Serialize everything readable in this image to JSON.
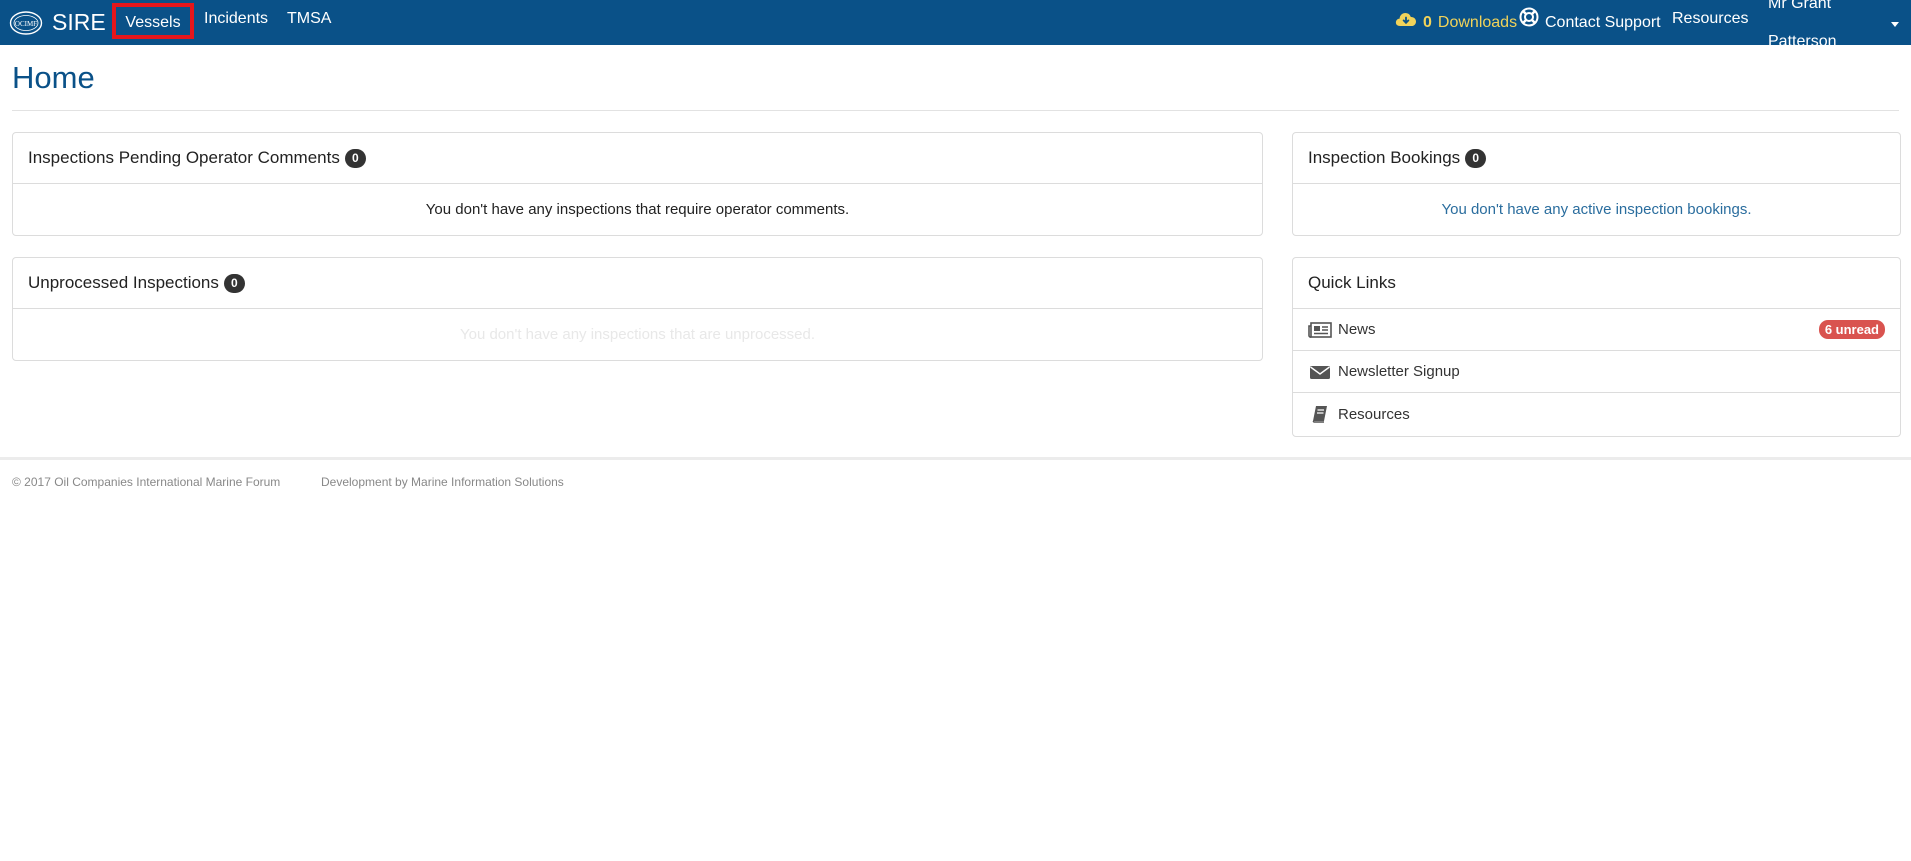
{
  "navbar": {
    "logo_text": "OCIMF",
    "brand": "SIRE",
    "items": [
      {
        "label": "Vessels"
      },
      {
        "label": "Incidents"
      },
      {
        "label": "TMSA"
      }
    ],
    "downloads_count": "0",
    "downloads_label": "Downloads",
    "support_label": "Contact Support",
    "resources_label": "Resources",
    "user_label": "Mr Grant Patterson"
  },
  "page": {
    "title": "Home"
  },
  "panels": {
    "comments": {
      "title": "Inspections Pending Operator Comments",
      "count": "0",
      "message": "You don't have any inspections that require operator comments."
    },
    "unprocessed": {
      "title": "Unprocessed Inspections",
      "count": "0",
      "message": "You don't have any inspections that are unprocessed."
    },
    "bookings": {
      "title": "Inspection Bookings",
      "count": "0",
      "message": "You don't have any active inspection bookings."
    },
    "quick_links": {
      "title": "Quick Links",
      "items": [
        {
          "label": "News",
          "icon": "newspaper-icon",
          "badge": "6 unread"
        },
        {
          "label": "Newsletter Signup",
          "icon": "envelope-icon"
        },
        {
          "label": "Resources",
          "icon": "book-icon"
        }
      ]
    }
  },
  "footer": {
    "copyright": "© 2017 Oil Companies International Marine Forum",
    "credit": "Development by Marine Information Solutions"
  },
  "colors": {
    "navbar": "#0a5188",
    "highlight_border": "#e5161b",
    "downloads": "#f1d35a",
    "badge_unread": "#d9534f",
    "link": "#2a6d9e"
  }
}
